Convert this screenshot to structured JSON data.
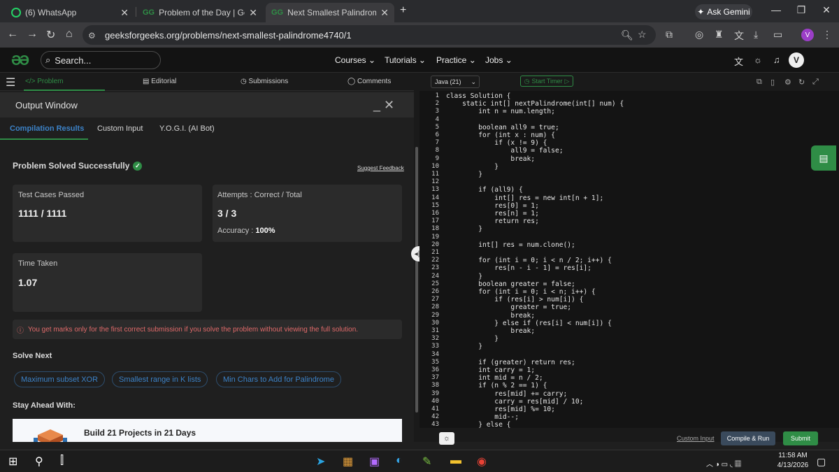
{
  "browser": {
    "tabs": [
      {
        "title": "(6) WhatsApp"
      },
      {
        "title": "Problem of the Day | GeeksforG"
      },
      {
        "title": "Next Smallest Palindrome | Prac"
      }
    ],
    "gemini_label": "Ask Gemini",
    "url": "geeksforgeeks.org/problems/next-smallest-palindrome4740/1",
    "profile_initial": "V"
  },
  "site": {
    "search_placeholder": "Search...",
    "menu": [
      "Courses",
      "Tutorials",
      "Practice",
      "Jobs"
    ],
    "user_initial": "V"
  },
  "left_tabs": [
    "Problem",
    "Editorial",
    "Submissions",
    "Comments"
  ],
  "output": {
    "title": "Output Window",
    "result_tabs": [
      "Compilation Results",
      "Custom Input",
      "Y.O.G.I. (AI Bot)"
    ],
    "status": "Problem Solved Successfully",
    "feedback": "Suggest Feedback",
    "tests_label": "Test Cases Passed",
    "tests_value": "1111 / 1111",
    "attempts_label": "Attempts : Correct / Total",
    "attempts_value": "3 / 3",
    "accuracy_label": "Accuracy :",
    "accuracy_value": "100%",
    "time_label": "Time Taken",
    "time_value": "1.07",
    "warning": "You get marks only for the first correct submission if you solve the problem without viewing the full solution.",
    "solve_next": "Solve Next",
    "next_problems": [
      "Maximum subset XOR",
      "Smallest range in K lists",
      "Min Chars to Add for Palindrome"
    ],
    "stay_ahead": "Stay Ahead With:",
    "promo": "Build 21 Projects in 21 Days"
  },
  "editor": {
    "language": "Java (21)",
    "timer": "Start Timer",
    "line_numbers": [
      "1",
      "2",
      "3",
      "4",
      "5",
      "6",
      "7",
      "8",
      "9",
      "10",
      "11",
      "12",
      "13",
      "14",
      "15",
      "16",
      "17",
      "18",
      "19",
      "20",
      "21",
      "22",
      "23",
      "24",
      "25",
      "26",
      "27",
      "28",
      "29",
      "30",
      "31",
      "32",
      "33",
      "34",
      "35",
      "36",
      "37",
      "38",
      "39",
      "40",
      "41",
      "42",
      "43"
    ],
    "code": [
      "class Solution {",
      "    static int[] nextPalindrome(int[] num) {",
      "        int n = num.length;",
      "",
      "        boolean all9 = true;",
      "        for (int x : num) {",
      "            if (x != 9) {",
      "                all9 = false;",
      "                break;",
      "            }",
      "        }",
      "",
      "        if (all9) {",
      "            int[] res = new int[n + 1];",
      "            res[0] = 1;",
      "            res[n] = 1;",
      "            return res;",
      "        }",
      "",
      "        int[] res = num.clone();",
      "",
      "        for (int i = 0; i < n / 2; i++) {",
      "            res[n - i - 1] = res[i];",
      "        }",
      "        boolean greater = false;",
      "        for (int i = 0; i < n; i++) {",
      "            if (res[i] > num[i]) {",
      "                greater = true;",
      "                break;",
      "            } else if (res[i] < num[i]) {",
      "                break;",
      "            }",
      "        }",
      "",
      "        if (greater) return res;",
      "        int carry = 1;",
      "        int mid = n / 2;",
      "        if (n % 2 == 1) {",
      "            res[mid] += carry;",
      "            carry = res[mid] / 10;",
      "            res[mid] %= 10;",
      "            mid--;",
      "        } else {"
    ],
    "custom_input": "Custom Input",
    "compile": "Compile & Run",
    "submit": "Submit"
  },
  "taskbar": {
    "time": "11:58 AM",
    "date": "4/13/2026"
  }
}
